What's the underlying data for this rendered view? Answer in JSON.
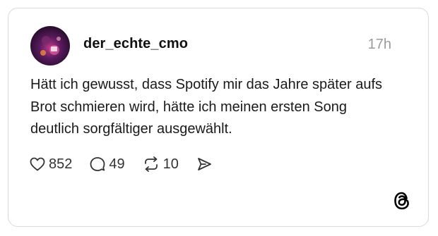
{
  "post": {
    "username": "der_echte_cmo",
    "timestamp": "17h",
    "text": "Hätt ich gewusst, dass Spotify mir das Jahre später aufs Brot schmieren wird, hätte ich meinen ersten Song deutlich sorgfältiger ausgewählt."
  },
  "actions": {
    "likes": "852",
    "replies": "49",
    "reposts": "10"
  },
  "icons": {
    "like": "heart-icon",
    "reply": "speech-bubble-icon",
    "repost": "repost-icon",
    "share": "send-icon",
    "brand": "threads-logo-icon"
  },
  "colors": {
    "text": "#1a1a1a",
    "muted": "#9a9a9a",
    "border": "#d9d9d9"
  }
}
